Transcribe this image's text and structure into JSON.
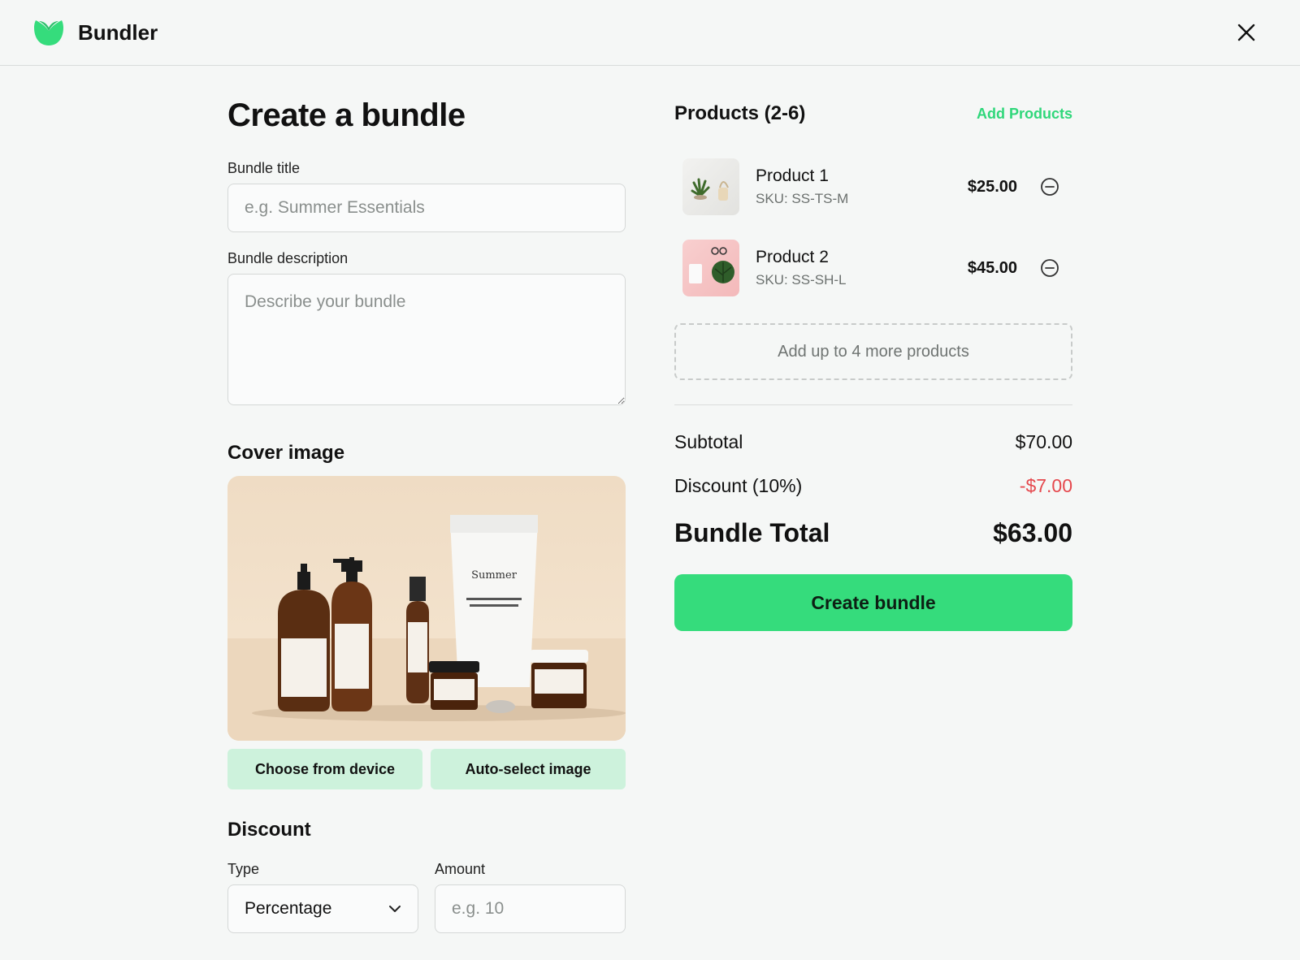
{
  "app": {
    "name": "Bundler",
    "accent_color": "#35dc7c",
    "close_icon": "close-icon",
    "logo_icon": "leaf-logo-icon"
  },
  "form": {
    "title": "Create a bundle",
    "bundle_title_label": "Bundle title",
    "bundle_title_placeholder": "e.g. Summer Essentials",
    "bundle_title_value": "",
    "bundle_description_label": "Bundle description",
    "bundle_description_placeholder": "Describe your bundle",
    "bundle_description_value": "",
    "cover_image_title": "Cover image",
    "choose_from_device_label": "Choose from device",
    "auto_select_label": "Auto-select image",
    "discount_title": "Discount",
    "type_label": "Type",
    "type_value": "Percentage",
    "amount_label": "Amount",
    "amount_placeholder": "e.g. 10",
    "amount_value": ""
  },
  "products": {
    "title": "Products (2-6)",
    "add_label": "Add Products",
    "items": [
      {
        "name": "Product 1",
        "sku": "SKU: SS-TS-M",
        "price": "$25.00"
      },
      {
        "name": "Product 2",
        "sku": "SKU: SS-SH-L",
        "price": "$45.00"
      }
    ],
    "add_more_label": "Add up to 4 more products"
  },
  "summary": {
    "subtotal_label": "Subtotal",
    "subtotal_value": "$70.00",
    "discount_label": "Discount (10%)",
    "discount_value": "-$7.00",
    "discount_color": "#e5484d",
    "total_label": "Bundle Total",
    "total_value": "$63.00",
    "create_label": "Create bundle"
  }
}
